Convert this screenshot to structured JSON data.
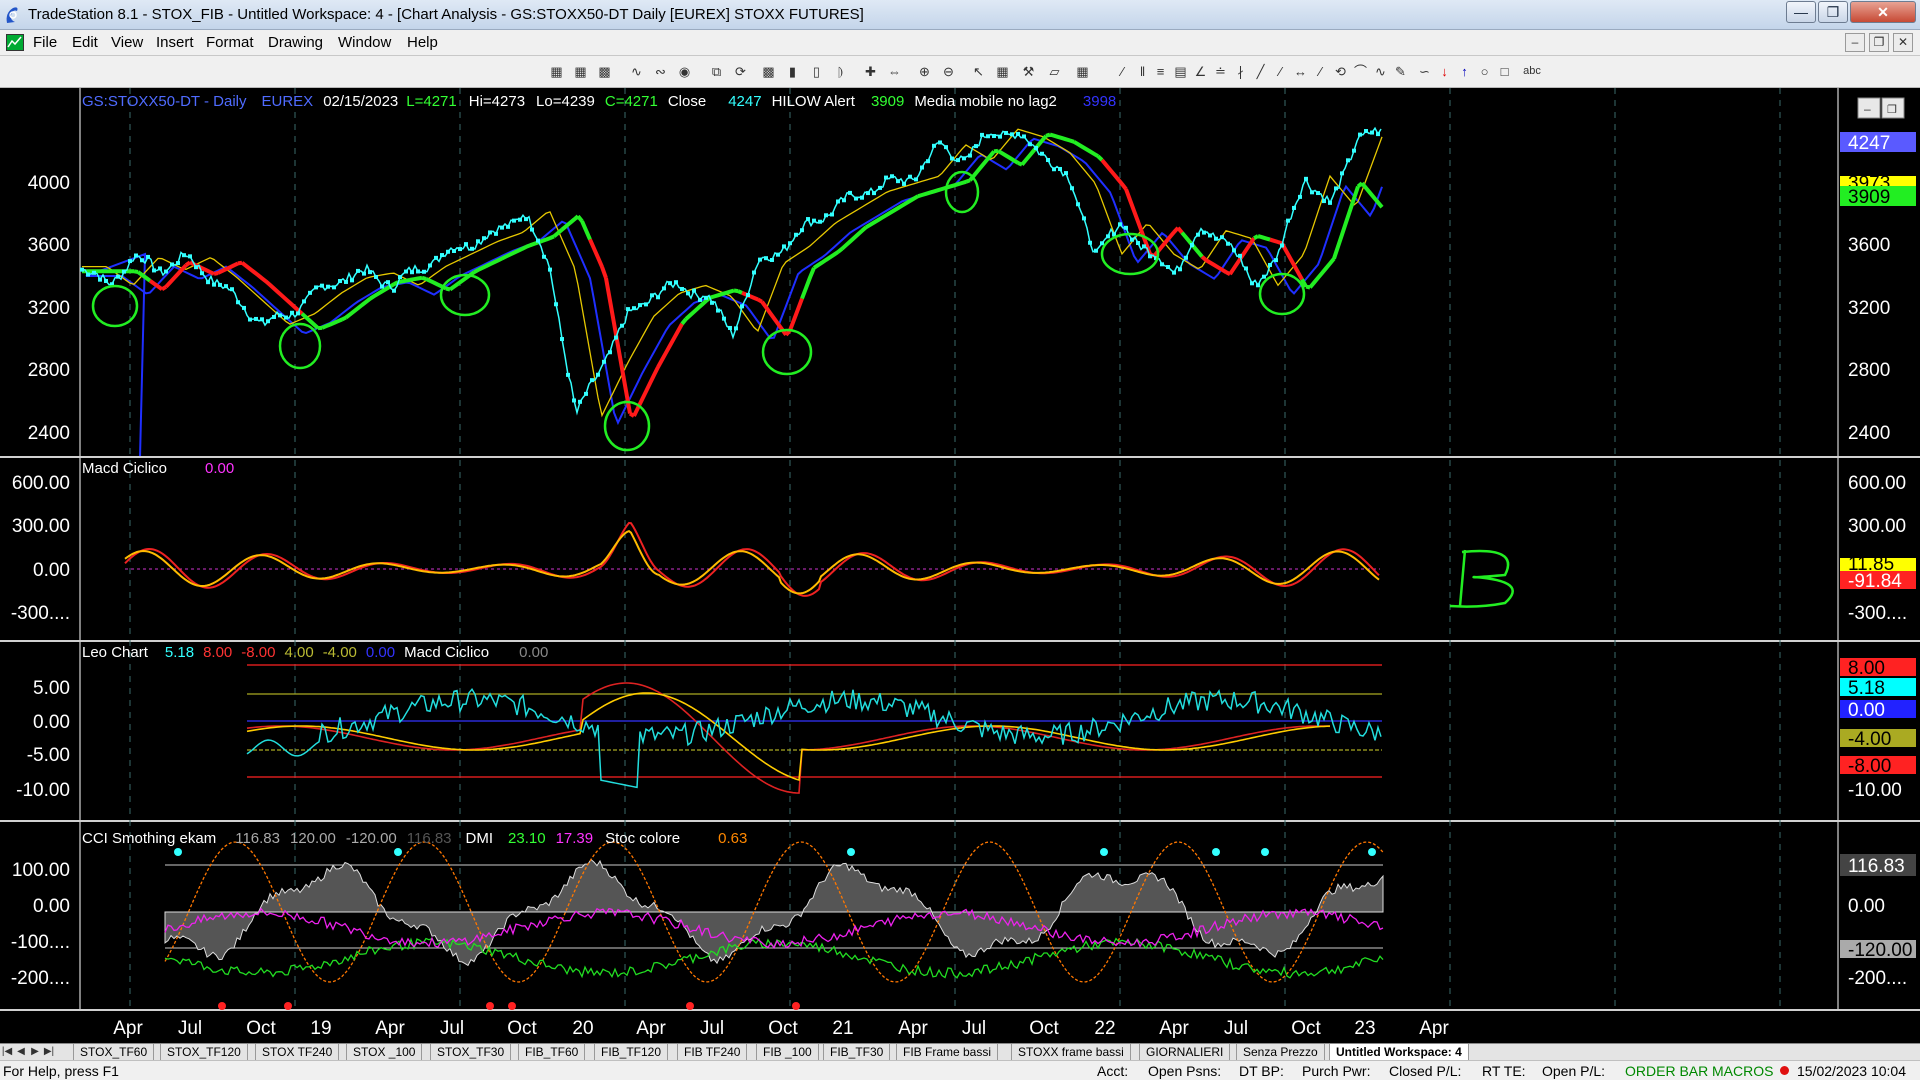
{
  "window": {
    "title": "TradeStation 8.1 - STOX_FIB - Untitled Workspace:  4 - [Chart Analysis - GS:STOXX50-DT  Daily  [EUREX] STOXX FUTURES]"
  },
  "menu": [
    "File",
    "Edit",
    "View",
    "Insert",
    "Format",
    "Drawing",
    "Window",
    "Help"
  ],
  "legends": {
    "price": [
      {
        "t": "GS:STOXX50-DT - Daily",
        "c": "#4f6bff"
      },
      {
        "t": "EUREX",
        "c": "#4f6bff"
      },
      {
        "t": "02/15/2023",
        "c": "#ffffff"
      },
      {
        "t": "L=4271",
        "c": "#33ff33"
      },
      {
        "t": "Hi=4273",
        "c": "#ffffff"
      },
      {
        "t": "Lo=4239",
        "c": "#ffffff"
      },
      {
        "t": "C=4271",
        "c": "#33ff33"
      },
      {
        "t": "Close",
        "c": "#ffffff"
      },
      {
        "t": "4247",
        "c": "#33ffff"
      },
      {
        "t": "HILOW Alert",
        "c": "#ffffff"
      },
      {
        "t": "3909",
        "c": "#33ff33"
      },
      {
        "t": "Media mobile no lag2",
        "c": "#ffffff"
      },
      {
        "t": "3998",
        "c": "#3333ff"
      }
    ],
    "macd": [
      {
        "t": "Macd Ciclico",
        "c": "#ffffff"
      },
      {
        "t": "0.00",
        "c": "#ff33ff"
      }
    ],
    "leo": [
      {
        "t": "Leo Chart",
        "c": "#ffffff"
      },
      {
        "t": "5.18",
        "c": "#33ffff"
      },
      {
        "t": "8.00",
        "c": "#ff3333"
      },
      {
        "t": "-8.00",
        "c": "#ff3333"
      },
      {
        "t": "4.00",
        "c": "#bbbb33"
      },
      {
        "t": "-4.00",
        "c": "#bbbb33"
      },
      {
        "t": "0.00",
        "c": "#3333ff"
      },
      {
        "t": "Macd Ciclico",
        "c": "#ffffff"
      },
      {
        "t": "0.00",
        "c": "#888888"
      }
    ],
    "cci": [
      {
        "t": "CCI Smothing ekam",
        "c": "#ffffff"
      },
      {
        "t": "116.83",
        "c": "#aaaaaa"
      },
      {
        "t": "120.00",
        "c": "#aaaaaa"
      },
      {
        "t": "-120.00",
        "c": "#aaaaaa"
      },
      {
        "t": "116.83",
        "c": "#555555"
      },
      {
        "t": "DMI",
        "c": "#ffffff"
      },
      {
        "t": "23.10",
        "c": "#33ff33"
      },
      {
        "t": "17.39",
        "c": "#ff33ff"
      },
      {
        "t": "Stoc colore",
        "c": "#ffffff"
      },
      {
        "t": "0.63",
        "c": "#ff8800"
      }
    ]
  },
  "axes": {
    "price": [
      "4000",
      "3600",
      "3200",
      "2800",
      "2400"
    ],
    "macd": [
      "600.00",
      "300.00",
      "0.00",
      "-300...."
    ],
    "leo": [
      "5.00",
      "0.00",
      "-5.00",
      "-10.00"
    ],
    "cci": [
      "100.00",
      "0.00",
      "-100....",
      "-200...."
    ],
    "months": [
      "Apr",
      "Jul",
      "Oct",
      "19",
      "Apr",
      "Jul",
      "Oct",
      "20",
      "Apr",
      "Jul",
      "Oct",
      "21",
      "Apr",
      "Jul",
      "Oct",
      "22",
      "Apr",
      "Jul",
      "Oct",
      "23",
      "Apr"
    ]
  },
  "right_labels": {
    "price": [
      {
        "t": "4247",
        "bg": "#5a5aff",
        "fg": "#ffffff"
      },
      {
        "t": "3973",
        "bg": "#ffff00",
        "fg": "#000000"
      },
      {
        "t": "3909",
        "bg": "#22ee22",
        "fg": "#000000"
      }
    ],
    "macd": [
      {
        "t": "11.85",
        "bg": "#ffff00",
        "fg": "#000000"
      },
      {
        "t": "-91.84",
        "bg": "#ff2222",
        "fg": "#ffffff"
      }
    ],
    "leo": [
      {
        "t": "8.00",
        "bg": "#ff2222",
        "fg": "#000000"
      },
      {
        "t": "5.18",
        "bg": "#00ffff",
        "fg": "#000000"
      },
      {
        "t": "0.00",
        "bg": "#2222ff",
        "fg": "#ffffff"
      },
      {
        "t": "-4.00",
        "bg": "#aaaa22",
        "fg": "#000000"
      },
      {
        "t": "-8.00",
        "bg": "#ff2222",
        "fg": "#000000"
      }
    ],
    "cci": [
      {
        "t": "116.83",
        "bg": "#444444",
        "fg": "#ffffff"
      },
      {
        "t": "-120.00",
        "bg": "#aaaaaa",
        "fg": "#000000"
      }
    ]
  },
  "price_series": {
    "x": [
      0,
      0.02,
      0.04,
      0.06,
      0.08,
      0.1,
      0.12,
      0.14,
      0.16,
      0.18,
      0.2,
      0.22,
      0.24,
      0.26,
      0.28,
      0.3,
      0.32,
      0.34,
      0.36,
      0.38,
      0.4,
      0.42,
      0.44,
      0.46,
      0.48,
      0.5,
      0.52,
      0.54,
      0.56,
      0.58,
      0.6,
      0.62,
      0.64,
      0.66,
      0.68,
      0.7,
      0.72,
      0.74,
      0.76,
      0.78,
      0.8,
      0.82,
      0.84,
      0.86,
      0.88,
      0.9,
      0.92,
      0.94,
      0.96,
      0.98,
      1
    ],
    "y": [
      3420,
      3300,
      3480,
      3400,
      3480,
      3350,
      3200,
      3050,
      3120,
      3250,
      3350,
      3380,
      3300,
      3420,
      3500,
      3580,
      3640,
      3780,
      3400,
      2460,
      2800,
      3100,
      3250,
      3300,
      3230,
      3000,
      3440,
      3550,
      3700,
      3800,
      3900,
      3950,
      4000,
      4200,
      4100,
      4300,
      4250,
      4150,
      3950,
      3500,
      3700,
      3500,
      3400,
      3650,
      3600,
      3300,
      3500,
      4000,
      3800,
      4250,
      4270
    ]
  },
  "markers": {
    "tabs": [
      "STOX_TF60",
      "STOX_TF120",
      "STOX TF240",
      "STOX _100",
      "STOX_TF30",
      "FIB_TF60",
      "FIB_TF120",
      "FIB TF240",
      "FIB _100",
      "FIB_TF30",
      "FIB Frame bassi",
      "STOXX frame bassi",
      "GIORNALIERI",
      "Senza Prezzo",
      "Untitled Workspace: 4"
    ]
  },
  "status": {
    "help": "For Help, press F1",
    "acct": "Acct:",
    "open_psns": "Open Psns:",
    "dt_bp": "DT BP:",
    "purch_pwr": "Purch Pwr:",
    "closed_pl": "Closed P/L:",
    "rt_te": "RT TE:",
    "open_pl": "Open P/L:",
    "order_bar": "ORDER BAR",
    "macros": "MACROS",
    "datetime": "15/02/2023 10:04"
  },
  "colors": {
    "price_dots": "#33ffff",
    "ma_red": "#ff1a1a",
    "ma_green": "#22ee22",
    "ma_blue": "#1f2fff",
    "ma_yellow": "#ffdd00",
    "annotation": "#22ee22"
  }
}
